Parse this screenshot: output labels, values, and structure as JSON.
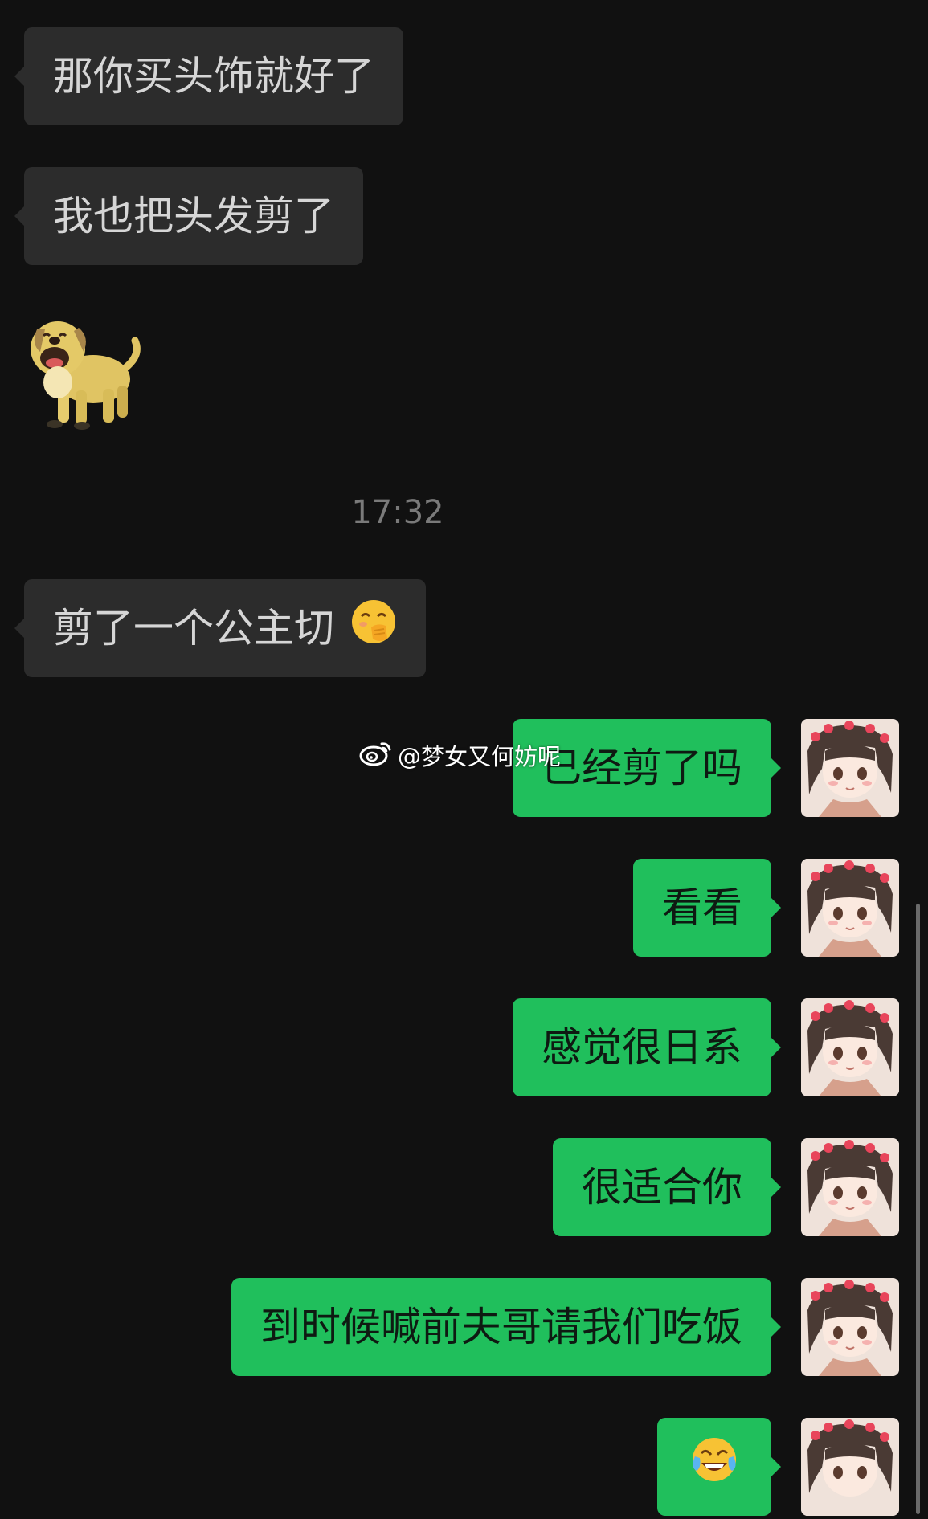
{
  "messages_incoming": [
    {
      "text": "那你买头饰就好了"
    },
    {
      "text": "我也把头发剪了"
    },
    {
      "text": "剪了一个公主切"
    }
  ],
  "sticker": {
    "icon": "laughing-dog-sticker"
  },
  "timestamp": "17:32",
  "incoming_emoji": {
    "icon": "hand-over-mouth-emoji"
  },
  "messages_outgoing": [
    {
      "text": "已经剪了吗"
    },
    {
      "text": "看看"
    },
    {
      "text": "感觉很日系"
    },
    {
      "text": "很适合你"
    },
    {
      "text": "到时候喊前夫哥请我们吃饭"
    }
  ],
  "outgoing_emoji": {
    "icon": "tears-of-joy-emoji"
  },
  "watermark": {
    "text": "@梦女又何妨呢",
    "icon": "weibo-icon"
  },
  "colors": {
    "background": "#111111",
    "incoming_bubble": "#2c2c2c",
    "outgoing_bubble": "#20bf5c"
  }
}
